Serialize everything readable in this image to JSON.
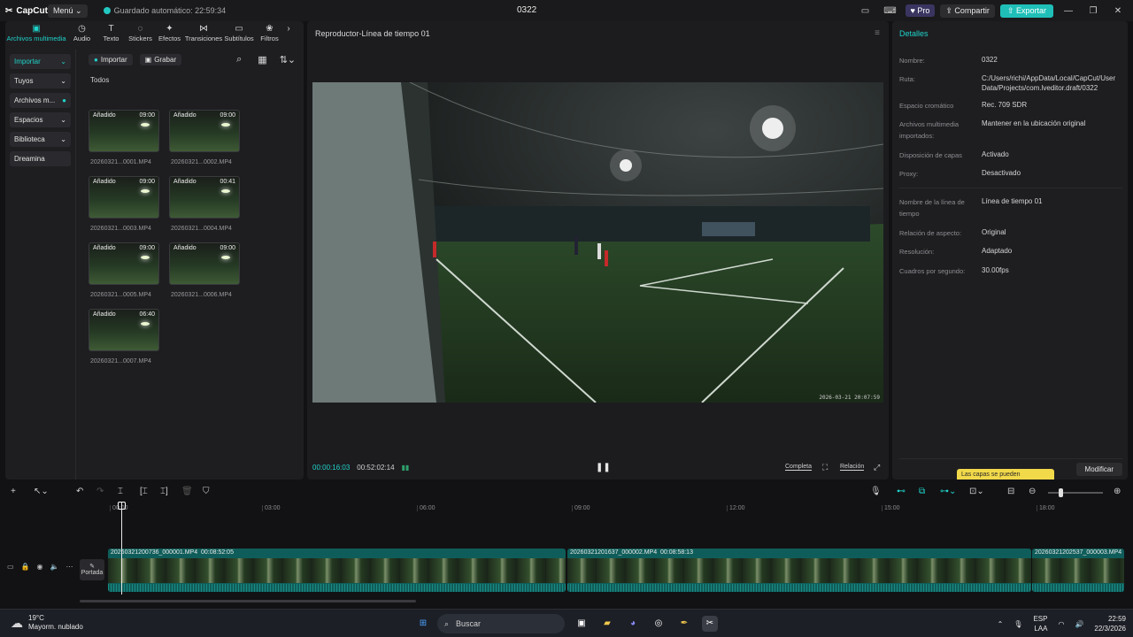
{
  "titlebar": {
    "logo": "CapCut",
    "menu": "Menú",
    "autosave": "Guardado automático: 22:59:34",
    "project": "0322",
    "pro": "Pro",
    "share": "Compartir",
    "export": "Exportar"
  },
  "tools": [
    {
      "label": "Archivos multimedia",
      "icon": "▣"
    },
    {
      "label": "Audio",
      "icon": "◷"
    },
    {
      "label": "Texto",
      "icon": "T"
    },
    {
      "label": "Stickers",
      "icon": "◌"
    },
    {
      "label": "Efectos",
      "icon": "✦"
    },
    {
      "label": "Transiciones",
      "icon": "⋈"
    },
    {
      "label": "Subtítulos",
      "icon": "▭"
    },
    {
      "label": "Filtros",
      "icon": "❀"
    }
  ],
  "sidenav": [
    "Importar",
    "Tuyos",
    "Archivos m...",
    "Espacios",
    "Biblioteca",
    "Dreamina"
  ],
  "media": {
    "import": "Importar",
    "record": "Grabar",
    "section": "Todos",
    "items": [
      {
        "tag": "Añadido",
        "duration": "09:00",
        "name": "20260321...0001.MP4"
      },
      {
        "tag": "Añadido",
        "duration": "09:00",
        "name": "20260321...0002.MP4"
      },
      {
        "tag": "Añadido",
        "duration": "09:00",
        "name": "20260321...0003.MP4"
      },
      {
        "tag": "Añadido",
        "duration": "00:41",
        "name": "20260321...0004.MP4"
      },
      {
        "tag": "Añadido",
        "duration": "09:00",
        "name": "20260321...0005.MP4"
      },
      {
        "tag": "Añadido",
        "duration": "09:00",
        "name": "20260321...0006.MP4"
      },
      {
        "tag": "Añadido",
        "duration": "06:40",
        "name": "20260321...0007.MP4"
      }
    ]
  },
  "player": {
    "title": "Reproductor-Línea de tiempo 01",
    "timestamp": "2026-03-21 20:07:59",
    "current": "00:00:16:03",
    "total": "00:52:02:14",
    "full": "Completa",
    "ratio": "Relación"
  },
  "details": {
    "title": "Detalles",
    "rows": [
      {
        "label": "Nombre:",
        "value": "0322"
      },
      {
        "label": "Ruta:",
        "value": "C:/Users/richi/AppData/Local/CapCut/User Data/Projects/com.lveditor.draft/0322"
      },
      {
        "label": "Espacio cromático",
        "value": "Rec. 709 SDR"
      },
      {
        "label": "Archivos multimedia importados:",
        "value": "Mantener en la ubicación original"
      },
      {
        "label": "Disposición de capas",
        "value": "Activado"
      },
      {
        "label": "Proxy:",
        "value": "Desactivado"
      },
      {
        "label": "Nombre de la línea de tiempo",
        "value": "Línea de tiempo 01"
      },
      {
        "label": "Relación de aspecto:",
        "value": "Original"
      },
      {
        "label": "Resolución:",
        "value": "Adaptado"
      },
      {
        "label": "Cuadros por segundo:",
        "value": "30.00fps"
      }
    ],
    "tooltip": "Las capas se pueden",
    "modify": "Modificar"
  },
  "timeline": {
    "ruler": [
      "00:00",
      "03:00",
      "06:00",
      "09:00",
      "12:00",
      "15:00",
      "18:00"
    ],
    "cover": "Portada",
    "clips": [
      {
        "name": "20260321200736_000001.MP4",
        "duration": "00:08:52:05"
      },
      {
        "name": "20260321201637_000002.MP4",
        "duration": "00:08:58:13"
      },
      {
        "name": "20260321202537_000003.MP4",
        "duration": ""
      }
    ]
  },
  "taskbar": {
    "temp": "19°C",
    "weather": "Mayorm. nublado",
    "search": "Buscar",
    "lang1": "ESP",
    "lang2": "LAA",
    "time": "22:59",
    "date": "22/3/2026"
  }
}
